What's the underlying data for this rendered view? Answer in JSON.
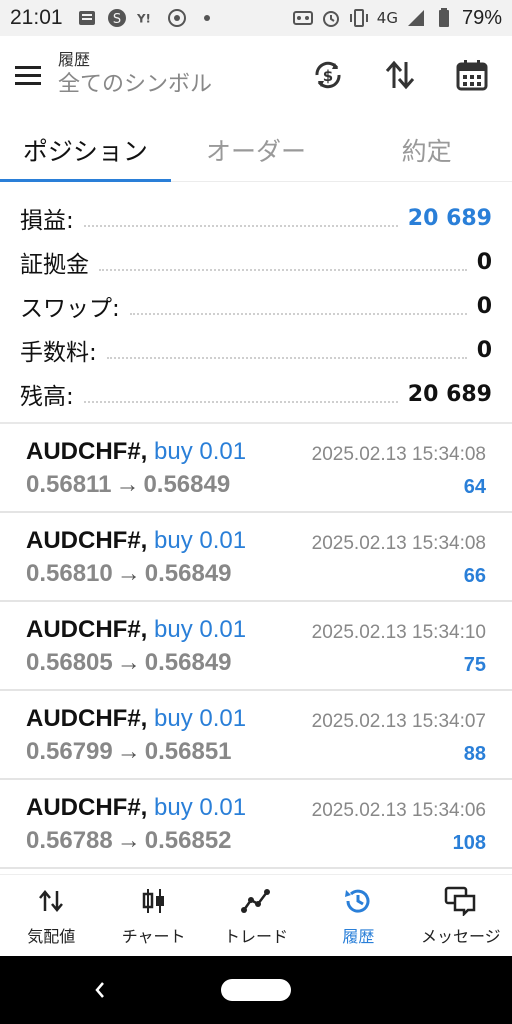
{
  "status_bar": {
    "time": "21:01",
    "network": "4G",
    "battery": "79%",
    "icons": [
      "news-icon",
      "s-icon",
      "yahoo-icon",
      "chrome-icon",
      "dot-icon",
      "voicemail-icon",
      "alarm-icon",
      "vibrate-icon",
      "signal-icon",
      "battery-icon"
    ]
  },
  "header": {
    "title": "履歴",
    "subtitle": "全てのシンボル"
  },
  "tabs": [
    {
      "label": "ポジション",
      "active": true
    },
    {
      "label": "オーダー",
      "active": false
    },
    {
      "label": "約定",
      "active": false
    }
  ],
  "summary": [
    {
      "label": "損益:",
      "value": "20 689",
      "color": "#2a7fd8"
    },
    {
      "label": "証拠金",
      "value": "0"
    },
    {
      "label": "スワップ:",
      "value": "0"
    },
    {
      "label": "手数料:",
      "value": "0"
    },
    {
      "label": "残高:",
      "value": "20 689"
    }
  ],
  "deals": [
    {
      "symbol": "AUDCHF#,",
      "side": "buy 0.01",
      "time": "2025.02.13 15:34:08",
      "open": "0.56811",
      "close": "0.56849",
      "profit": "64"
    },
    {
      "symbol": "AUDCHF#,",
      "side": "buy 0.01",
      "time": "2025.02.13 15:34:08",
      "open": "0.56810",
      "close": "0.56849",
      "profit": "66"
    },
    {
      "symbol": "AUDCHF#,",
      "side": "buy 0.01",
      "time": "2025.02.13 15:34:10",
      "open": "0.56805",
      "close": "0.56849",
      "profit": "75"
    },
    {
      "symbol": "AUDCHF#,",
      "side": "buy 0.01",
      "time": "2025.02.13 15:34:07",
      "open": "0.56799",
      "close": "0.56851",
      "profit": "88"
    },
    {
      "symbol": "AUDCHF#,",
      "side": "buy 0.01",
      "time": "2025.02.13 15:34:06",
      "open": "0.56788",
      "close": "0.56852",
      "profit": "108"
    }
  ],
  "arrow": "→",
  "bottom_nav": [
    {
      "label": "気配値",
      "icon": "quotes-icon"
    },
    {
      "label": "チャート",
      "icon": "chart-icon"
    },
    {
      "label": "トレード",
      "icon": "trade-icon"
    },
    {
      "label": "履歴",
      "icon": "history-icon",
      "active": true
    },
    {
      "label": "メッセージ",
      "icon": "messages-icon"
    }
  ],
  "colors": {
    "accent": "#2a7fd8"
  }
}
